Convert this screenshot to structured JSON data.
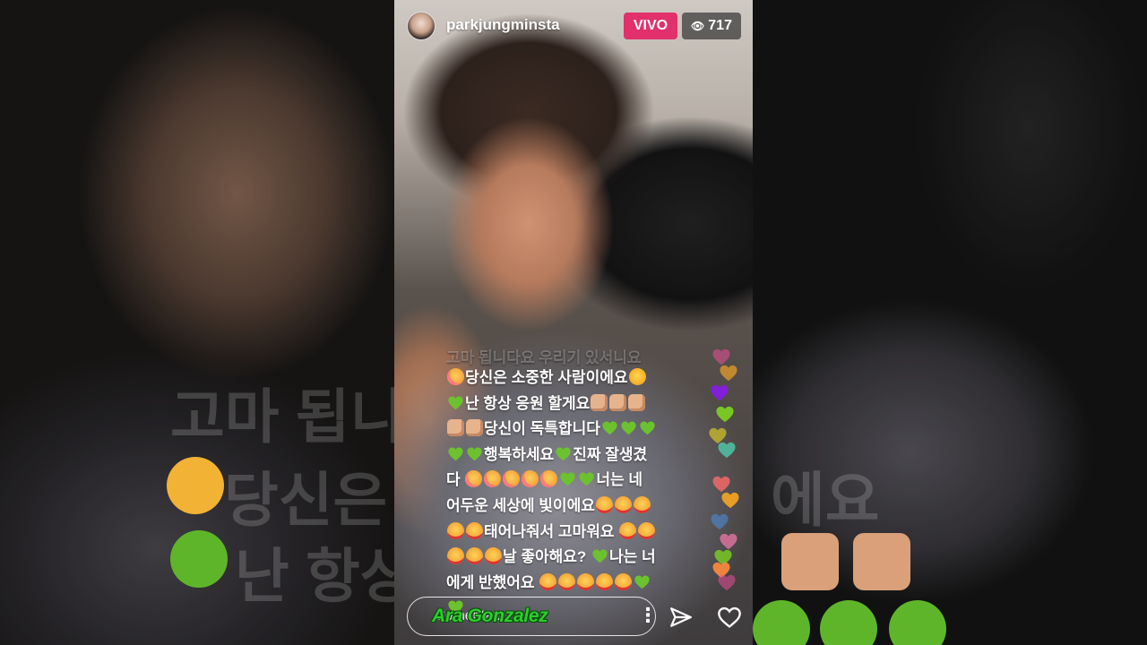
{
  "stream": {
    "username": "parkjungminsta",
    "live_badge": "VIVO",
    "viewer_count": "717",
    "viewer_icon": "eye-icon"
  },
  "comments": {
    "faded_line": "고마 됩니다요 우리기 있서니요",
    "lines": [
      [
        "emoji:blush",
        "text:당신은 소중한 사람이에요",
        "emoji:crown"
      ],
      [
        "heart:green",
        "text:난 항상 응원 할게요",
        "emoji:fist",
        "emoji:fist",
        "emoji:fist"
      ],
      [
        "emoji:fist",
        "emoji:fist",
        "text:당신이 독특합니다",
        "heart:green",
        "heart:green",
        "heart:green"
      ],
      [
        "heart:green",
        "heart:green",
        "text:행복하세요",
        "heart:green",
        "text:진짜 잘생겼"
      ],
      [
        "text:다 ",
        "emoji:blush",
        "emoji:blush",
        "emoji:blush",
        "emoji:blush",
        "emoji:blush",
        "heart:green",
        "heart:green",
        "text:너는 네"
      ],
      [
        "text:어두운 세상에 빛이에요",
        "emoji:hearteyes",
        "emoji:hearteyes",
        "emoji:hearteyes"
      ],
      [
        "emoji:hearteyes",
        "emoji:hearteyes",
        "text:태어나줘서 고마워요 ",
        "emoji:hearteyes",
        "emoji:hearteyes"
      ],
      [
        "emoji:hearteyes",
        "emoji:hearteyes",
        "emoji:hearteyes",
        "text:날 좋아해요? ",
        "heart:green",
        "text:나는 너"
      ],
      [
        "text:에게 반했어요 ",
        "emoji:hearteyes",
        "emoji:hearteyes",
        "emoji:hearteyes",
        "emoji:hearteyes",
        "emoji:hearteyes",
        "heart:green"
      ],
      [
        "heart:green"
      ]
    ]
  },
  "floating_hearts": [
    "#e94e9b",
    "#f5a623",
    "#9013fe",
    "#7ed321",
    "#f8e71c",
    "#50e3c2",
    "#ff6b6b",
    "#f5a623",
    "#4a90e2",
    "#ff7eb3",
    "#7ed321",
    "#ff8a3d",
    "#e94e9b"
  ],
  "bottom_bar": {
    "comment_placeholder": "Comentar...",
    "more_icon": "more-dots-icon",
    "send_icon": "send-icon",
    "like_icon": "heart-outline-icon"
  },
  "watermark": "Ara Gonzalez",
  "colors": {
    "live_badge": "#e1306c",
    "green_heart": "#6cc22e",
    "watermark": "#2ecc2e"
  }
}
